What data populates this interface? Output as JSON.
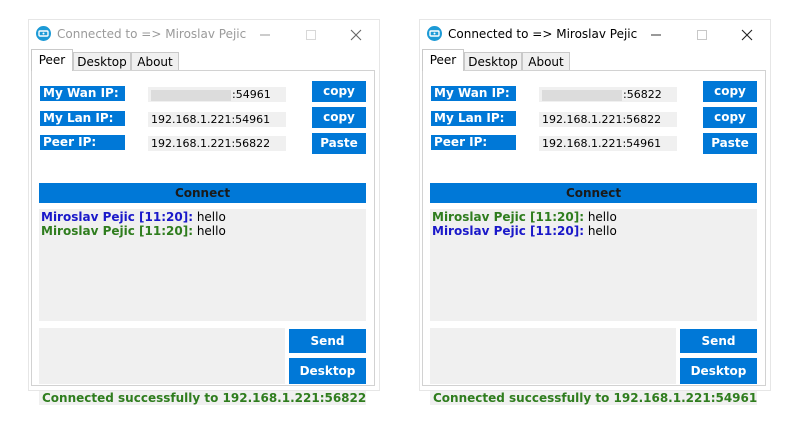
{
  "colors": {
    "accent": "#0078d7",
    "status_green": "#2f7d1e",
    "field_bg": "#f0f0f0",
    "name_blue": "#1a18c9",
    "name_green": "#2f7d1e"
  },
  "windows": [
    {
      "state": "inactive",
      "title": "Connected to => Miroslav Pejic",
      "tabs": [
        "Peer",
        "Desktop",
        "About"
      ],
      "labels": {
        "wan": "My Wan IP:",
        "lan": "My Lan IP:",
        "peer": "Peer IP:"
      },
      "fields": {
        "wan_port": ":54961",
        "lan": "192.168.1.221:54961",
        "peer": "192.168.1.221:56822"
      },
      "buttons": {
        "copy_wan": "copy",
        "copy_lan": "copy",
        "paste": "Paste",
        "connect": "Connect",
        "send": "Send",
        "desktop": "Desktop"
      },
      "chat": [
        {
          "name": "Miroslav Pejic [11:20]:",
          "text": " hello",
          "color": "#1a18c9"
        },
        {
          "name": "Miroslav Pejic [11:20]:",
          "text": " hello",
          "color": "#2f7d1e"
        }
      ],
      "status": "Connected successfully to 192.168.1.221:56822"
    },
    {
      "state": "active",
      "title": "Connected to => Miroslav Pejic",
      "tabs": [
        "Peer",
        "Desktop",
        "About"
      ],
      "labels": {
        "wan": "My Wan IP:",
        "lan": "My Lan IP:",
        "peer": "Peer IP:"
      },
      "fields": {
        "wan_port": ":56822",
        "lan": "192.168.1.221:56822",
        "peer": "192.168.1.221:54961"
      },
      "buttons": {
        "copy_wan": "copy",
        "copy_lan": "copy",
        "paste": "Paste",
        "connect": "Connect",
        "send": "Send",
        "desktop": "Desktop"
      },
      "chat": [
        {
          "name": "Miroslav Pejic [11:20]:",
          "text": " hello",
          "color": "#2f7d1e"
        },
        {
          "name": "Miroslav Pejic [11:20]:",
          "text": " hello",
          "color": "#1a18c9"
        }
      ],
      "status": "Connected successfully to 192.168.1.221:54961"
    }
  ]
}
